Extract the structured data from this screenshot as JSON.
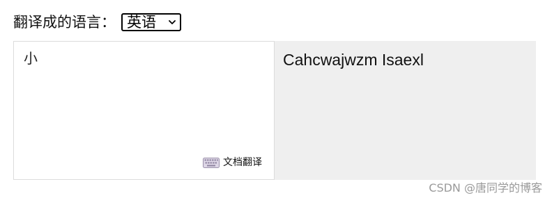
{
  "toolbar": {
    "target_language_label": "翻译成的语言：",
    "target_language_value": "英语",
    "dropdown_icon": "chevron-down-icon"
  },
  "input_panel": {
    "text": "小",
    "document_translate_label": "文档翻译",
    "document_translate_icon": "keyboard-icon"
  },
  "output_panel": {
    "text": "Cahcwajwzm Isaexl"
  },
  "watermark": {
    "text": "CSDN @唐同学的博客"
  },
  "colors": {
    "output_background": "#efefef",
    "border": "#dcdcdc",
    "watermark": "#9a9a9a"
  }
}
